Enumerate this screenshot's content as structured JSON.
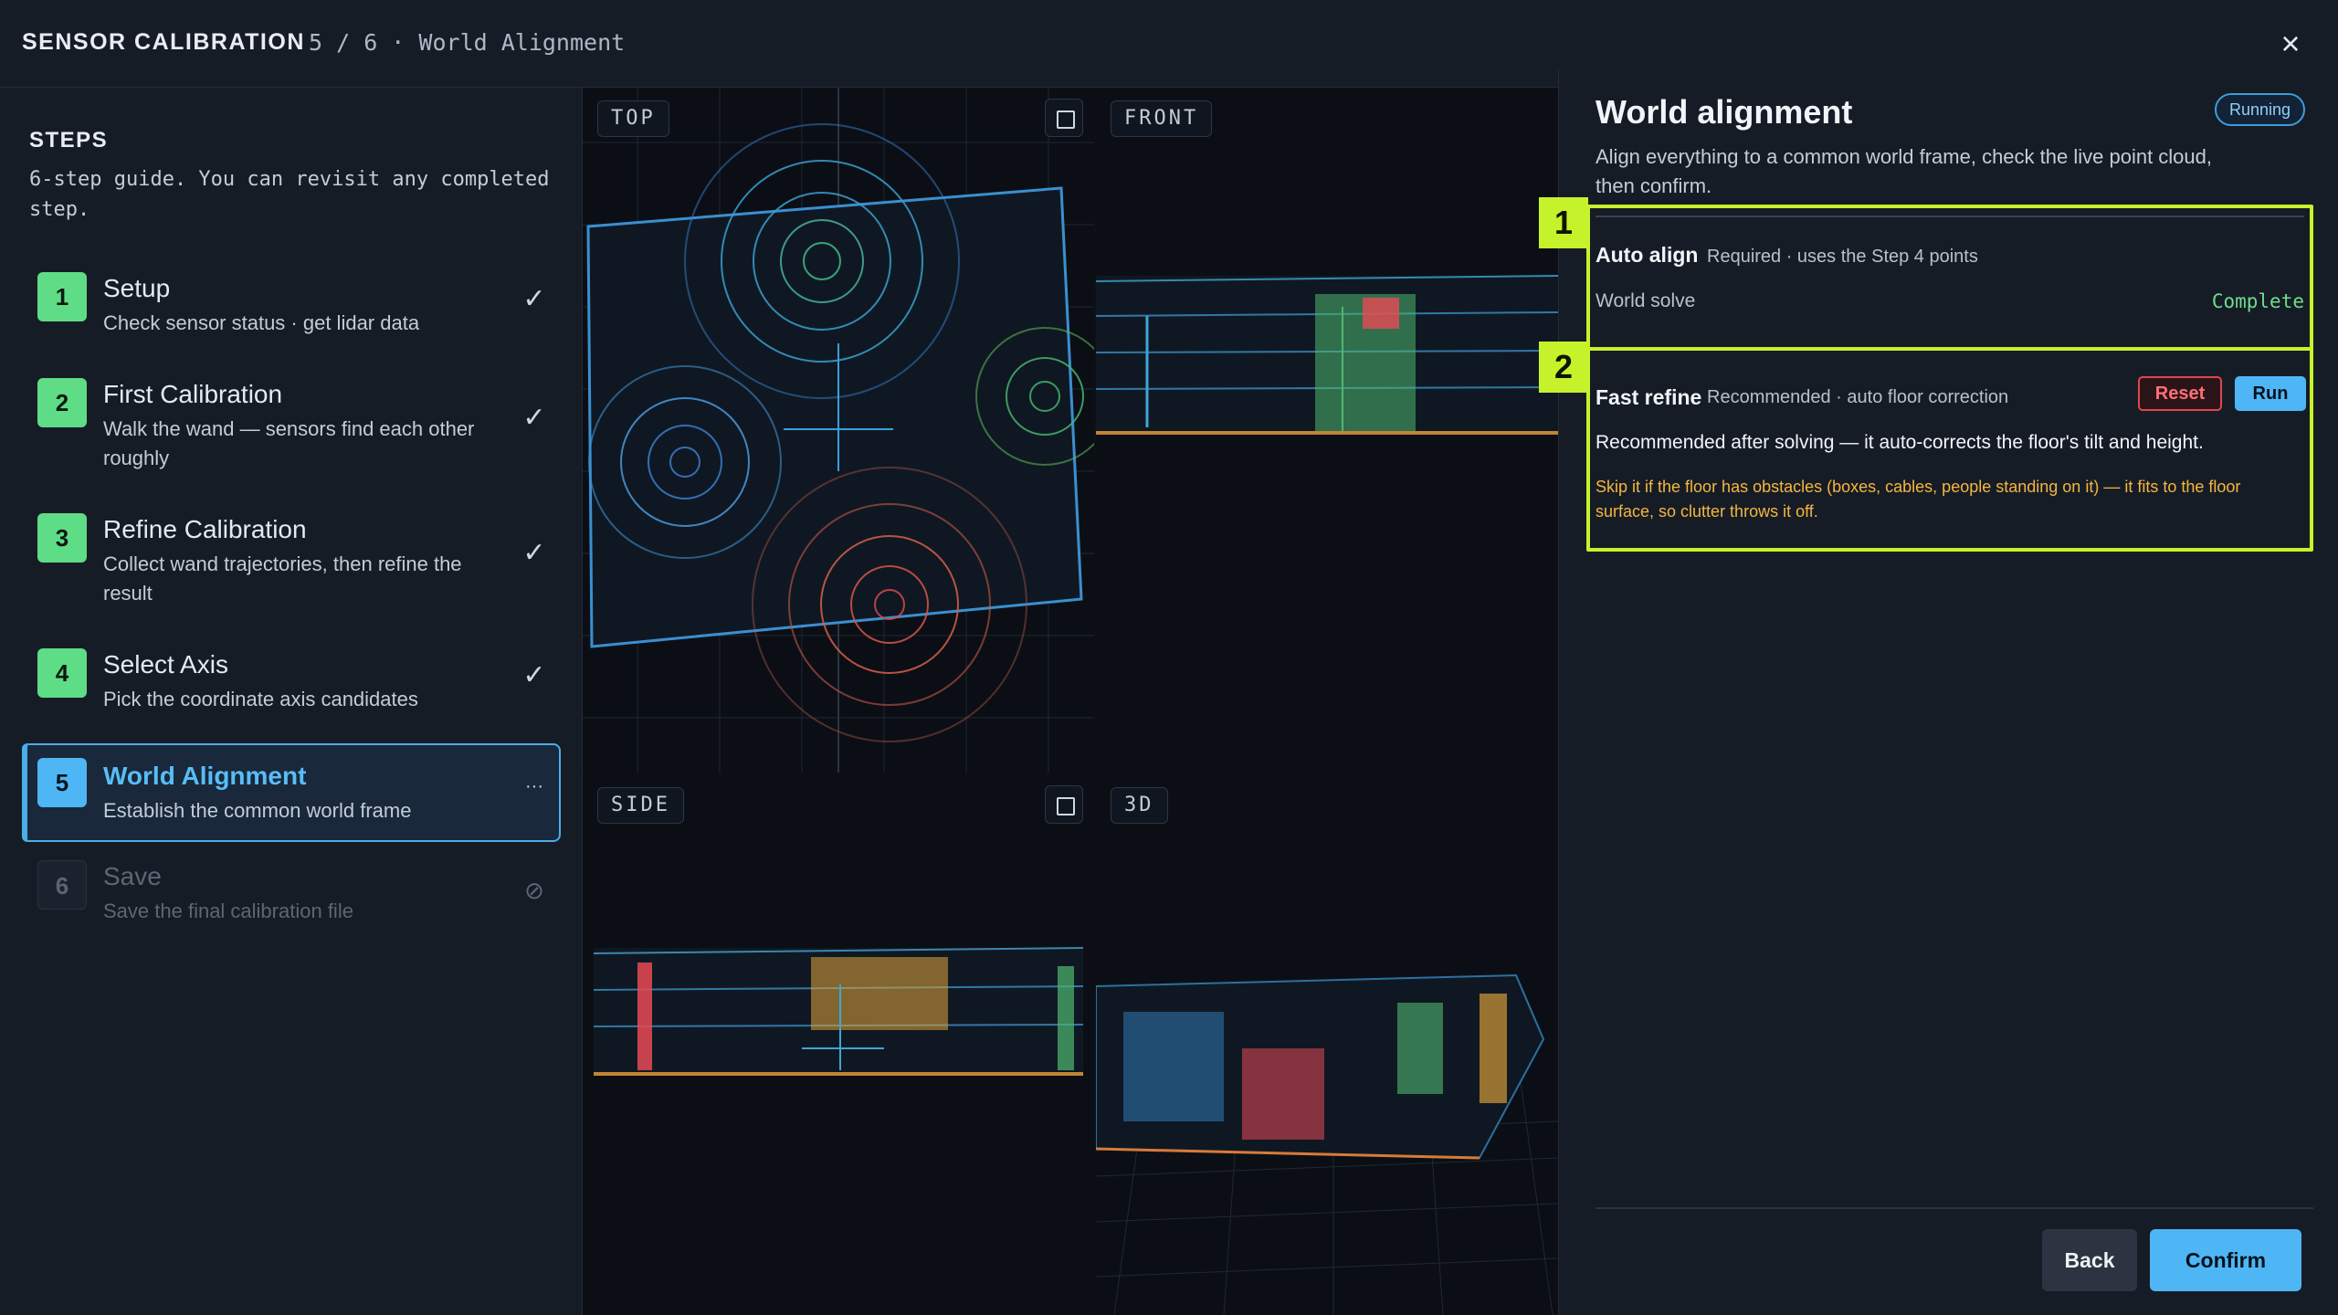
{
  "header": {
    "title": "SENSOR CALIBRATION",
    "progress": "5 / 6 · World Alignment",
    "close_icon": "close-icon"
  },
  "sidebar": {
    "heading": "STEPS",
    "description": "6-step guide. You can revisit any completed step.",
    "steps": [
      {
        "num": "1",
        "title": "Setup",
        "desc": "Check sensor status · get lidar data",
        "state": "complete",
        "mark": "✓"
      },
      {
        "num": "2",
        "title": "First Calibration",
        "desc": "Walk the wand — sensors find each other roughly",
        "state": "complete",
        "mark": "✓"
      },
      {
        "num": "3",
        "title": "Refine Calibration",
        "desc": "Collect wand trajectories, then refine the result",
        "state": "complete",
        "mark": "✓"
      },
      {
        "num": "4",
        "title": "Select Axis",
        "desc": "Pick the coordinate axis candidates",
        "state": "complete",
        "mark": "✓"
      },
      {
        "num": "5",
        "title": "World Alignment",
        "desc": "Establish the common world frame",
        "state": "active",
        "mark": "···"
      },
      {
        "num": "6",
        "title": "Save",
        "desc": "Save the final calibration file",
        "state": "locked",
        "mark": "⊘"
      }
    ]
  },
  "viewports": [
    {
      "label": "TOP",
      "icon": "maximize-icon"
    },
    {
      "label": "FRONT",
      "icon": "maximize-icon"
    },
    {
      "label": "SIDE",
      "icon": "maximize-icon"
    },
    {
      "label": "3D",
      "icon": "maximize-icon"
    }
  ],
  "panel": {
    "title": "World alignment",
    "status": "Running",
    "description": "Align everything to a common world frame, check the live point cloud, then confirm.",
    "sections": [
      {
        "badge": "1",
        "title": "Auto align",
        "subtitle": "Required · uses the Step 4 points",
        "row_label": "World solve",
        "row_status": "Complete"
      },
      {
        "badge": "2",
        "title": "Fast refine",
        "subtitle": "Recommended · auto floor correction",
        "reset_label": "Reset",
        "run_label": "Run",
        "text": "Recommended after solving — it auto-corrects the floor's tilt and height.",
        "warning": "Skip it if the floor has obstacles (boxes, cables, people standing on it) — it fits to the floor surface, so clutter throws it off."
      }
    ],
    "back_label": "Back",
    "confirm_label": "Confirm"
  },
  "colors": {
    "accent": "#4fb6f5",
    "complete": "#5fdc86",
    "highlight": "#c6f22b",
    "warning": "#f5b63e",
    "danger": "#e2454b"
  }
}
